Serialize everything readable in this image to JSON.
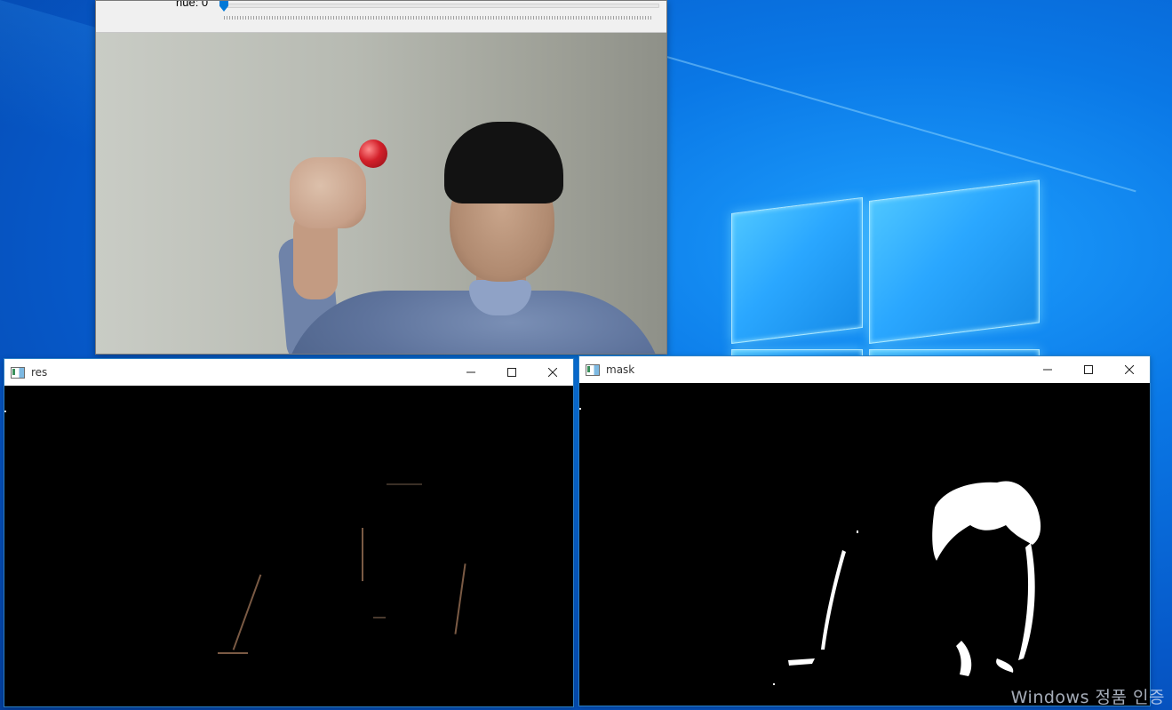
{
  "desktop": {
    "icon_labels": [
      "",
      "",
      ""
    ],
    "watermark": "Windows 정품 인증"
  },
  "trackbar_window": {
    "trackbar_label": "hue: 0",
    "trackbar_value": 0
  },
  "res_window": {
    "title": "res",
    "minimize_icon": "minimize-icon",
    "maximize_icon": "maximize-icon",
    "close_icon": "close-icon"
  },
  "mask_window": {
    "title": "mask",
    "minimize_icon": "minimize-icon",
    "maximize_icon": "maximize-icon",
    "close_icon": "close-icon"
  },
  "colors": {
    "accent": "#0078d7",
    "window_border": "#2b80c6",
    "desktop": "#0a78e6"
  }
}
